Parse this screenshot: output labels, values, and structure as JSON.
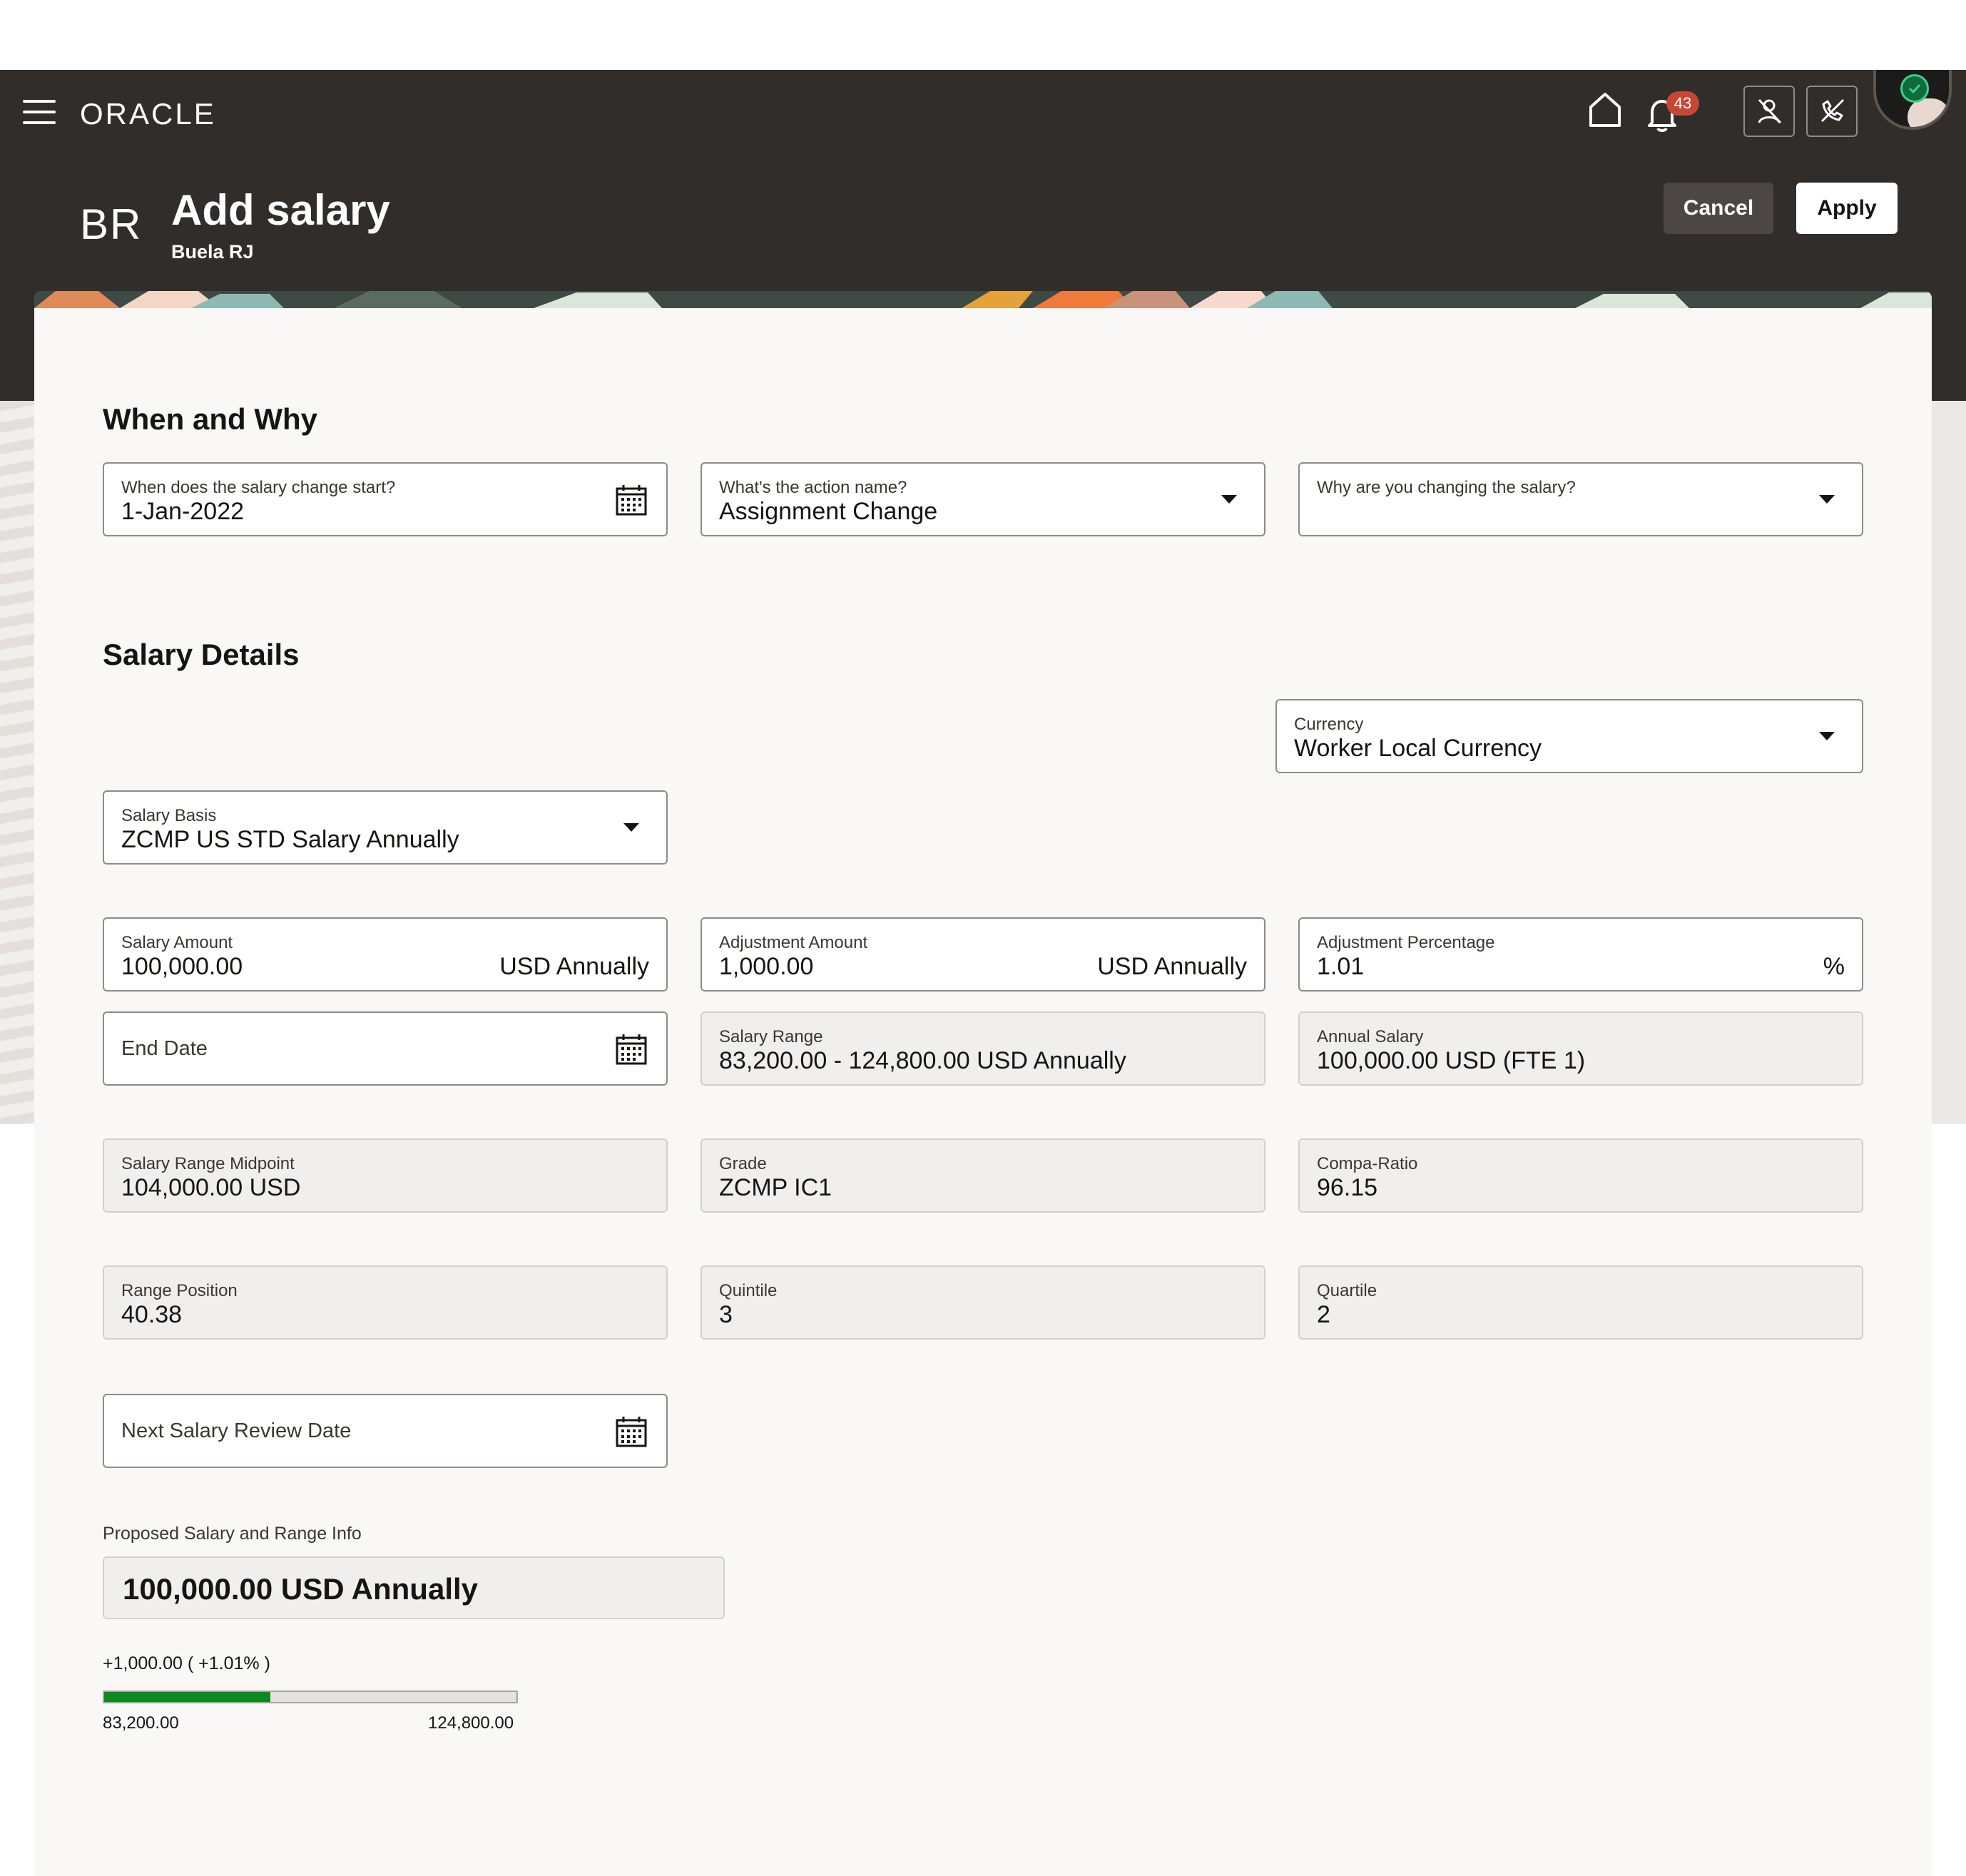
{
  "header": {
    "brand": "ORACLE",
    "notification_count": "43",
    "initials": "BR",
    "title": "Add salary",
    "subtitle": "Buela RJ",
    "cancel_label": "Cancel",
    "apply_label": "Apply"
  },
  "when_why": {
    "section_title": "When and Why",
    "start_date_label": "When does the salary change start?",
    "start_date_value": "1-Jan-2022",
    "action_label": "What's the action name?",
    "action_value": "Assignment Change",
    "reason_label": "Why are you changing the salary?"
  },
  "salary_details": {
    "section_title": "Salary Details",
    "currency_label": "Currency",
    "currency_value": "Worker Local Currency",
    "salary_basis_label": "Salary Basis",
    "salary_basis_value": "ZCMP US STD Salary Annually",
    "salary_amount_label": "Salary Amount",
    "salary_amount_value": "100,000.00",
    "salary_amount_suffix": "USD Annually",
    "adjustment_amount_label": "Adjustment Amount",
    "adjustment_amount_value": "1,000.00",
    "adjustment_amount_suffix": "USD Annually",
    "adjustment_pct_label": "Adjustment Percentage",
    "adjustment_pct_value": "1.01",
    "adjustment_pct_suffix": "%",
    "end_date_placeholder": "End Date",
    "salary_range_label": "Salary Range",
    "salary_range_value": "83,200.00 - 124,800.00 USD Annually",
    "annual_salary_label": "Annual Salary",
    "annual_salary_value": "100,000.00 USD (FTE 1)",
    "midpoint_label": "Salary Range Midpoint",
    "midpoint_value": "104,000.00 USD",
    "grade_label": "Grade",
    "grade_value": "ZCMP IC1",
    "compa_ratio_label": "Compa-Ratio",
    "compa_ratio_value": "96.15",
    "range_position_label": "Range Position",
    "range_position_value": "40.38",
    "quintile_label": "Quintile",
    "quintile_value": "3",
    "quartile_label": "Quartile",
    "quartile_value": "2",
    "next_review_placeholder": "Next Salary Review Date"
  },
  "proposed": {
    "label": "Proposed Salary and Range Info",
    "value": "100,000.00 USD Annually",
    "delta": "+1,000.00 ( +1.01% )",
    "range_min": "83,200.00",
    "range_max": "124,800.00",
    "range_fill_fraction": 0.4038
  },
  "colors": {
    "header_bg": "#312d2a",
    "range_fill": "#0a8a1f",
    "badge": "#c74634"
  }
}
